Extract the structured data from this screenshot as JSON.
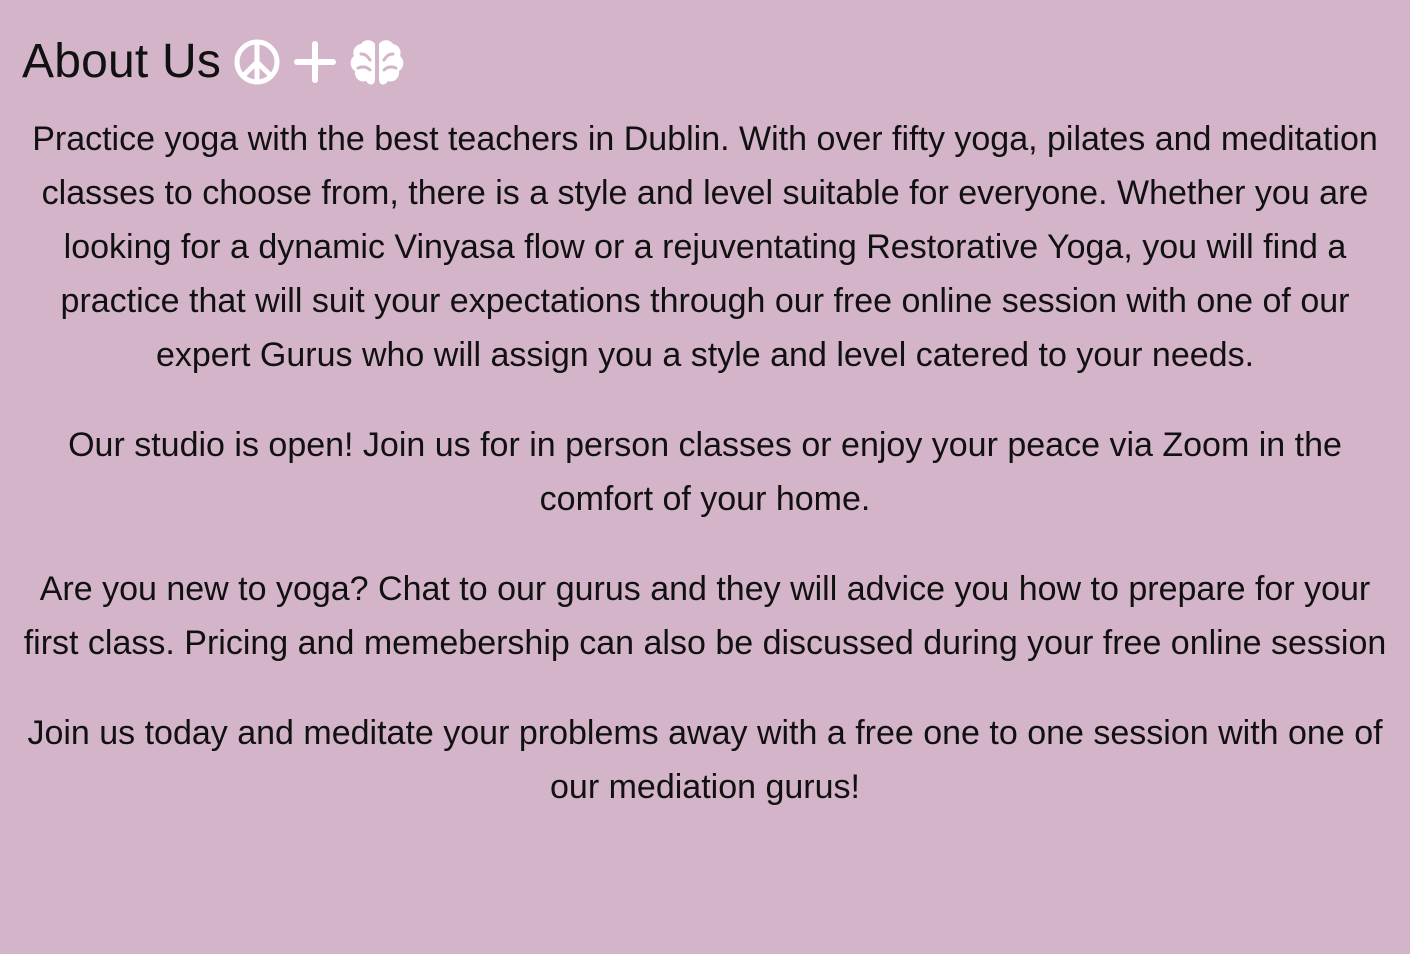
{
  "about": {
    "title": "About Us",
    "icons": [
      "peace-icon",
      "plus-icon",
      "brain-icon"
    ],
    "paragraphs": [
      "Practice yoga with the best teachers in Dublin. With over fifty yoga, pilates and meditation classes to choose from, there is a style and level suitable for everyone. Whether you are looking for a dynamic Vinyasa flow or a rejuventating Restorative Yoga, you will find a practice that will suit your expectations through our free online session with one of our expert Gurus who will assign you a style and level catered to your needs.",
      "Our studio is open! Join us for in person classes or enjoy your peace via Zoom in the comfort of your home.",
      "Are you new to yoga? Chat to our gurus and they will advice you how to prepare for your first class. Pricing and memebership can also be discussed during your free online session",
      "Join us today and meditate your problems away with a free one to one session with one of our mediation gurus!"
    ]
  },
  "colors": {
    "background": "#d4b4c9",
    "text": "#111111",
    "icon": "#ffffff"
  }
}
